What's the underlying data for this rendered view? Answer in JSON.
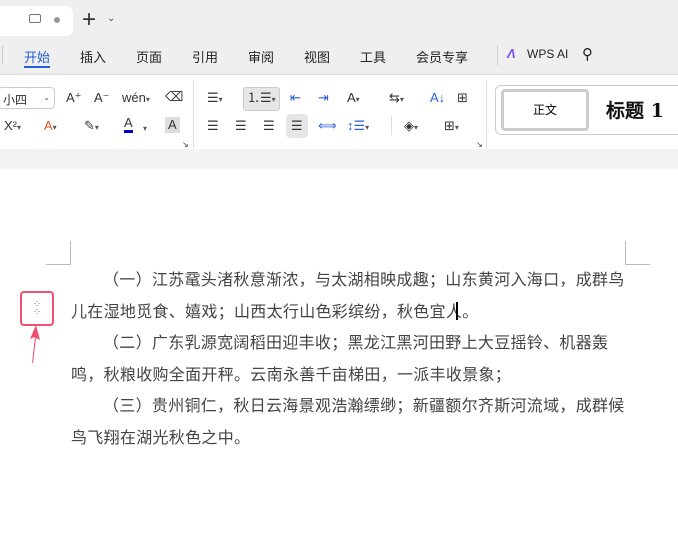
{
  "tabs": {
    "new_tab": "+",
    "dropdown": "⌄"
  },
  "menu": {
    "items": [
      "开始",
      "插入",
      "页面",
      "引用",
      "审阅",
      "视图",
      "工具",
      "会员专享"
    ],
    "ai_label": "WPS AI"
  },
  "ribbon": {
    "font_size": "小四",
    "styles": {
      "normal": "正文",
      "heading1": "标题 1"
    }
  },
  "document": {
    "paragraphs": [
      "（一）江苏鼋头渚秋意渐浓，与太湖相映成趣；山东黄河入海口，成群鸟儿在湿地觅食、嬉戏；山西太行山色彩缤纷，秋色宜人。",
      "（二）广东乳源宽阔稻田迎丰收；黑龙江黑河田野上大豆摇铃、机器轰鸣，秋粮收购全面开秤。云南永善千亩梯田，一派丰收景象；",
      "（三）贵州铜仁，秋日云海景观浩瀚缥缈；新疆额尔齐斯河流域，成群候鸟飞翔在湖光秋色之中。"
    ]
  },
  "colors": {
    "accent": "#1f5fd6",
    "highlight": "#f0506e"
  }
}
